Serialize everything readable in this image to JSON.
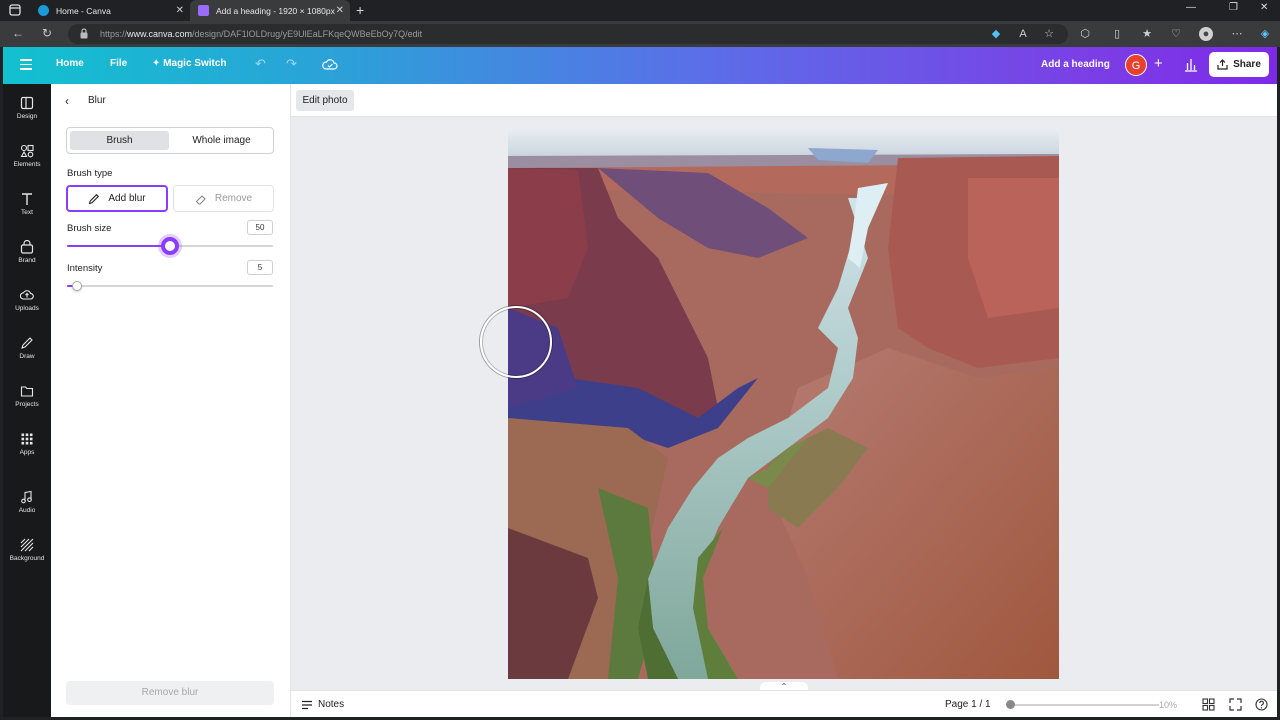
{
  "browser": {
    "tabs": [
      {
        "title": "Home - Canva",
        "active": false
      },
      {
        "title": "Add a heading - 1920 × 1080px",
        "active": true
      }
    ],
    "url_prefix": "https://",
    "url_domain": "www.canva.com",
    "url_path": "/design/DAF1lOLDrug/yE9UlEaLFKqeQWBeEbOy7Q/edit"
  },
  "header": {
    "home": "Home",
    "file": "File",
    "magic_switch": "Magic Switch",
    "doc_title": "Add a heading",
    "avatar_letter": "G",
    "share": "Share"
  },
  "rail": [
    {
      "label": "Design",
      "icon": "design-icon"
    },
    {
      "label": "Elements",
      "icon": "elements-icon"
    },
    {
      "label": "Text",
      "icon": "text-icon"
    },
    {
      "label": "Brand",
      "icon": "brand-icon"
    },
    {
      "label": "Uploads",
      "icon": "uploads-icon"
    },
    {
      "label": "Draw",
      "icon": "draw-icon"
    },
    {
      "label": "Projects",
      "icon": "projects-icon"
    },
    {
      "label": "Apps",
      "icon": "apps-icon"
    },
    {
      "label": "Audio",
      "icon": "audio-icon"
    },
    {
      "label": "Background",
      "icon": "background-icon"
    }
  ],
  "panel": {
    "title": "Blur",
    "tabs": {
      "brush": "Brush",
      "whole": "Whole image",
      "selected": "Brush"
    },
    "brush_type_label": "Brush type",
    "add_blur": "Add blur",
    "remove": "Remove",
    "brush_size_label": "Brush size",
    "brush_size": "50",
    "brush_size_fraction": 0.5,
    "intensity_label": "Intensity",
    "intensity": "5",
    "intensity_fraction": 0.05,
    "remove_blur": "Remove blur"
  },
  "context_bar": {
    "edit_photo": "Edit photo"
  },
  "footer": {
    "notes": "Notes",
    "page": "Page 1 / 1",
    "zoom": "10%"
  },
  "colors": {
    "accent": "#8b3dff",
    "avatar": "#e8402c"
  }
}
